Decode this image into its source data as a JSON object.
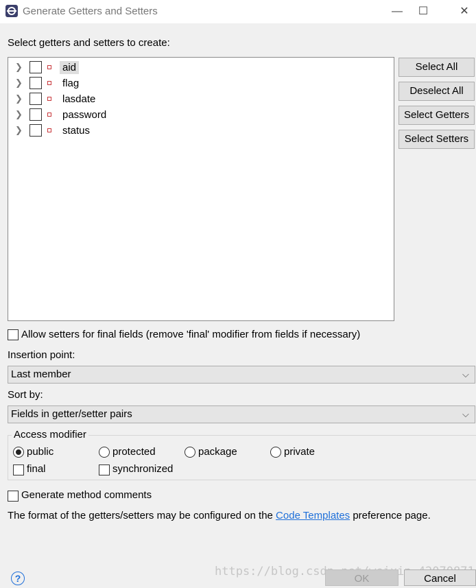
{
  "window": {
    "title": "Generate Getters and Setters",
    "minimize_glyph": "—",
    "maximize_glyph": "☐",
    "close_glyph": "✕"
  },
  "fields_label": "Select getters and setters to create:",
  "fields": [
    {
      "name": "aid",
      "selected": true,
      "checked": false
    },
    {
      "name": "flag",
      "selected": false,
      "checked": false
    },
    {
      "name": "lasdate",
      "selected": false,
      "checked": false
    },
    {
      "name": "password",
      "selected": false,
      "checked": false
    },
    {
      "name": "status",
      "selected": false,
      "checked": false
    }
  ],
  "buttons": {
    "select_all": "Select All",
    "deselect_all": "Deselect All",
    "select_getters": "Select Getters",
    "select_setters": "Select Setters"
  },
  "allow_setters_final": {
    "label": "Allow setters for final fields (remove 'final' modifier from fields if necessary)",
    "checked": false
  },
  "insertion_point": {
    "label": "Insertion point:",
    "value": "Last member"
  },
  "sort_by": {
    "label": "Sort by:",
    "value": "Fields in getter/setter pairs"
  },
  "access_modifier": {
    "title": "Access modifier",
    "options": [
      "public",
      "protected",
      "package",
      "private"
    ],
    "selected": "public",
    "final_label": "final",
    "synchronized_label": "synchronized"
  },
  "generate_comments": {
    "label": "Generate method comments",
    "checked": false
  },
  "footer_note": {
    "before": "The format of the getters/setters may be configured on the ",
    "link": "Code Templates",
    "after": " preference page."
  },
  "help_glyph": "?",
  "ok_label": "OK",
  "cancel_label": "Cancel",
  "watermark": "https://blog.csdn.net/weixin_42070871",
  "colors": {
    "link": "#1e6fd9",
    "field_icon": "#c8383c",
    "background": "#f0f0f0"
  }
}
